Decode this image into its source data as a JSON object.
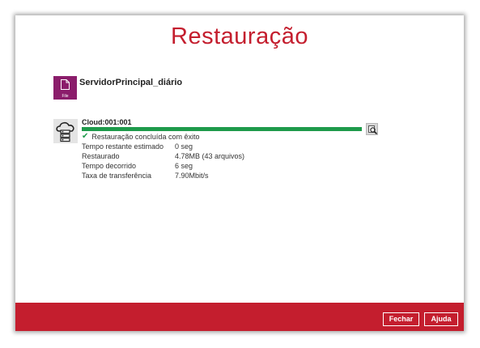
{
  "dialog": {
    "title": "Restauração"
  },
  "backup_set": {
    "icon": "file-icon",
    "icon_label": "File",
    "icon_color": "#8b1d6b",
    "name": "ServidorPrincipal_diário"
  },
  "destination": {
    "icon": "cloud-server-icon",
    "name": "Cloud:001:001",
    "progress": 1.0,
    "progress_color": "#1e9a4b",
    "status": "Restauração concluída com êxito",
    "stats": [
      {
        "label": "Tempo restante estimado",
        "value": "0 seg"
      },
      {
        "label": "Restaurado",
        "value": "4.78MB (43 arquivos)"
      },
      {
        "label": "Tempo decorrido",
        "value": "6 seg"
      },
      {
        "label": "Taxa de transferência",
        "value": "7.90Mbit/s"
      }
    ]
  },
  "footer": {
    "color": "#c41e2e",
    "close_label": "Fechar",
    "help_label": "Ajuda"
  }
}
